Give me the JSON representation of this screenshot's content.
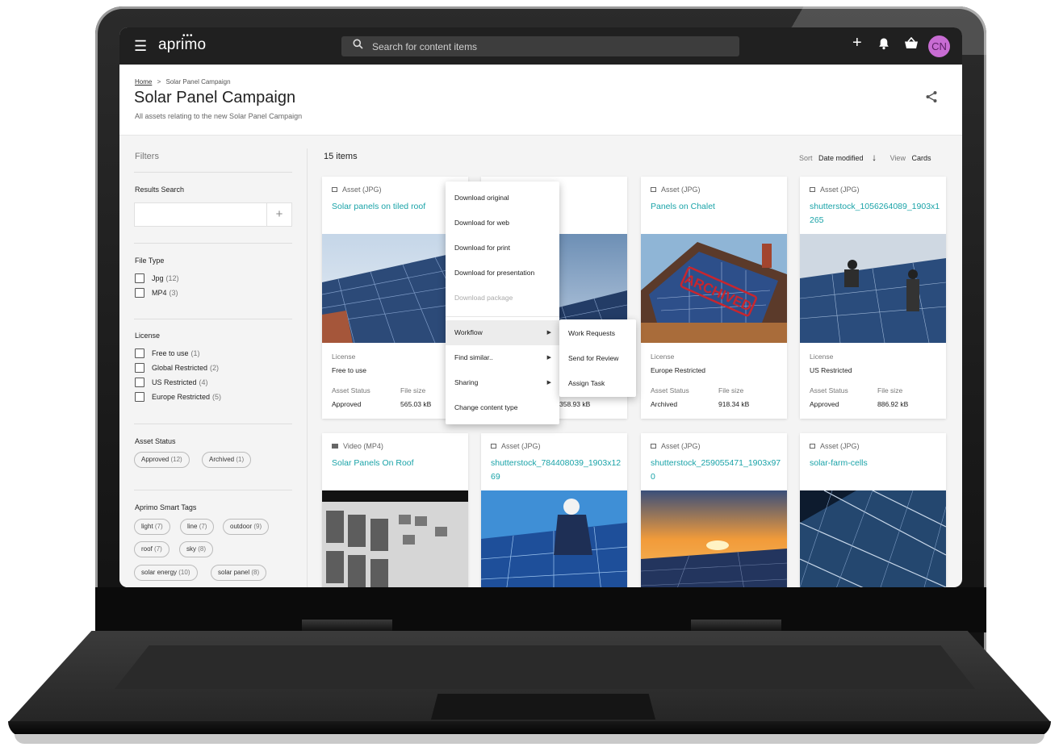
{
  "app": {
    "logo": "aprimo",
    "logo_dots": "•••",
    "search_placeholder": "Search for content items",
    "avatar_initials": "CN"
  },
  "page": {
    "breadcrumb_home": "Home",
    "breadcrumb_sep": ">",
    "breadcrumb_current": "Solar Panel Campaign",
    "title": "Solar Panel Campaign",
    "subtitle": "All assets relating to the new Solar Panel Campaign"
  },
  "sidebar": {
    "filters_label": "Filters",
    "results_search_label": "Results Search",
    "file_type_label": "File Type",
    "file_types": [
      {
        "label": "Jpg",
        "count": "(12)"
      },
      {
        "label": "MP4",
        "count": "(3)"
      }
    ],
    "license_label": "License",
    "licenses": [
      {
        "label": "Free to use",
        "count": "(1)"
      },
      {
        "label": "Global Restricted",
        "count": "(2)"
      },
      {
        "label": "US Restricted",
        "count": "(4)"
      },
      {
        "label": "Europe Restricted",
        "count": "(5)"
      }
    ],
    "asset_status_label": "Asset Status",
    "statuses": [
      {
        "label": "Approved",
        "count": "(12)"
      },
      {
        "label": "Archived",
        "count": "(1)"
      }
    ],
    "smart_tags_label": "Aprimo Smart Tags",
    "tags": [
      {
        "label": "light",
        "count": "(7)"
      },
      {
        "label": "line",
        "count": "(7)"
      },
      {
        "label": "outdoor",
        "count": "(9)"
      },
      {
        "label": "roof",
        "count": "(7)"
      },
      {
        "label": "sky",
        "count": "(8)"
      },
      {
        "label": "solar energy",
        "count": "(10)"
      },
      {
        "label": "solar panel",
        "count": "(8)"
      }
    ]
  },
  "results": {
    "items_count": "15 items",
    "sort_label": "Sort",
    "sort_value": "Date modified",
    "view_label": "View",
    "view_value": "Cards"
  },
  "card_labels": {
    "license": "License",
    "asset_status": "Asset Status",
    "file_size": "File size"
  },
  "cards": [
    {
      "type": "Asset (JPG)",
      "name": "Solar panels on tiled roof",
      "license": "Free to use",
      "status": "Approved",
      "size": "565.03 kB"
    },
    {
      "type": "",
      "name": "",
      "license": "",
      "status": "",
      "size": "358.93 kB"
    },
    {
      "type": "Asset (JPG)",
      "name": "Panels on Chalet",
      "license": "Europe Restricted",
      "status": "Archived",
      "size": "918.34 kB",
      "stamp": "ARCHIVED"
    },
    {
      "type": "Asset (JPG)",
      "name": "shutterstock_1056264089_1903x1265",
      "license": "US Restricted",
      "status": "Approved",
      "size": "886.92 kB"
    },
    {
      "type": "Video (MP4)",
      "name": "Solar Panels On Roof"
    },
    {
      "type": "Asset (JPG)",
      "name": "shutterstock_784408039_1903x1269"
    },
    {
      "type": "Asset (JPG)",
      "name": "shutterstock_259055471_1903x970"
    },
    {
      "type": "Asset (JPG)",
      "name": "solar-farm-cells"
    }
  ],
  "context_menu": {
    "items": [
      "Download original",
      "Download for web",
      "Download for print",
      "Download for presentation",
      "Download package",
      "Workflow",
      "Find similar..",
      "Sharing",
      "Change content type"
    ],
    "submenu": [
      "Work Requests",
      "Send for Review",
      "Assign Task"
    ]
  },
  "colors": {
    "topbar": "#202020",
    "accent_link": "#1aa3a8",
    "avatar": "#c86cd3"
  }
}
